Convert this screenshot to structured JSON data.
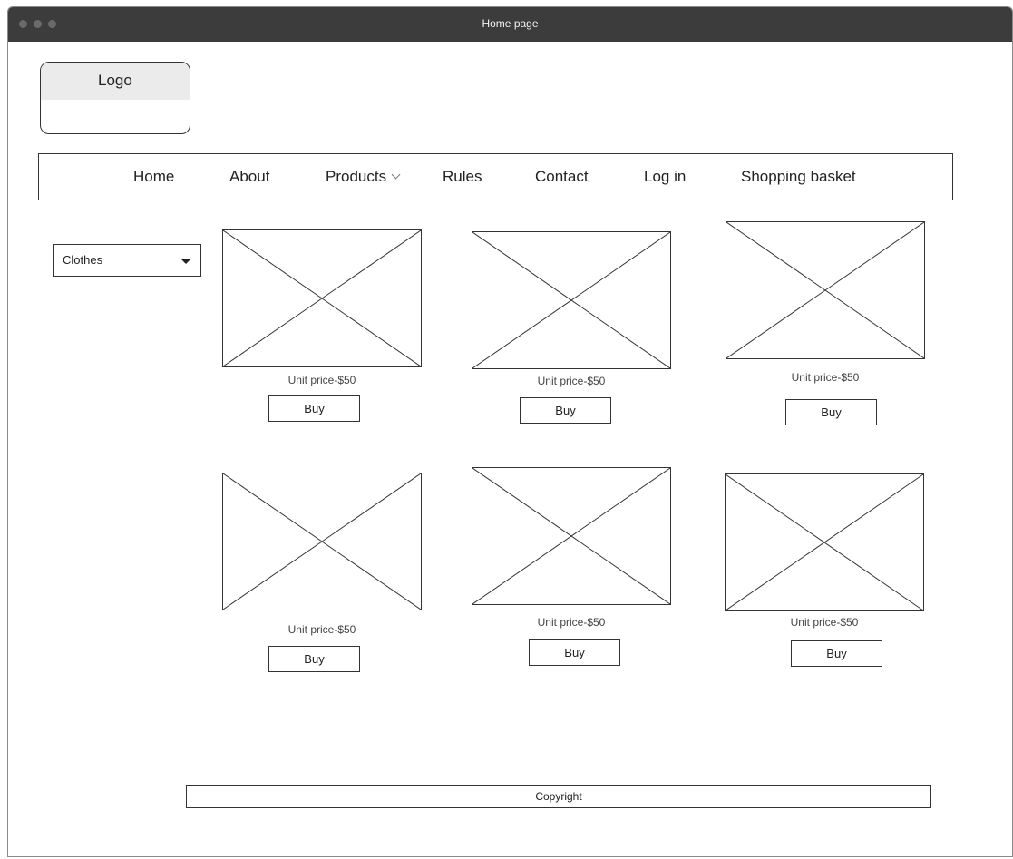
{
  "window": {
    "title": "Home page"
  },
  "logo": {
    "label": "Logo"
  },
  "nav": {
    "items": [
      {
        "label": "Home"
      },
      {
        "label": "About"
      },
      {
        "label": "Products"
      },
      {
        "label": "Rules"
      },
      {
        "label": "Contact"
      },
      {
        "label": "Log in"
      },
      {
        "label": "Shopping basket"
      }
    ]
  },
  "filter": {
    "selected": "Clothes"
  },
  "products": [
    {
      "price": "Unit price-$50",
      "buy_label": "Buy"
    },
    {
      "price": "Unit price-$50",
      "buy_label": "Buy"
    },
    {
      "price": "Unit price-$50",
      "buy_label": "Buy"
    },
    {
      "price": "Unit price-$50",
      "buy_label": "Buy"
    },
    {
      "price": "Unit price-$50",
      "buy_label": "Buy"
    },
    {
      "price": "Unit price-$50",
      "buy_label": "Buy"
    }
  ],
  "footer": {
    "text": "Copyright"
  },
  "colors": {
    "titlebar": "#3c3c3c",
    "logo_header": "#ebebeb",
    "border": "#333333"
  },
  "icons": {
    "products_dropdown": "chevron-down-icon",
    "select_arrow": "caret-down-icon",
    "image_placeholder": "image-placeholder-icon"
  }
}
